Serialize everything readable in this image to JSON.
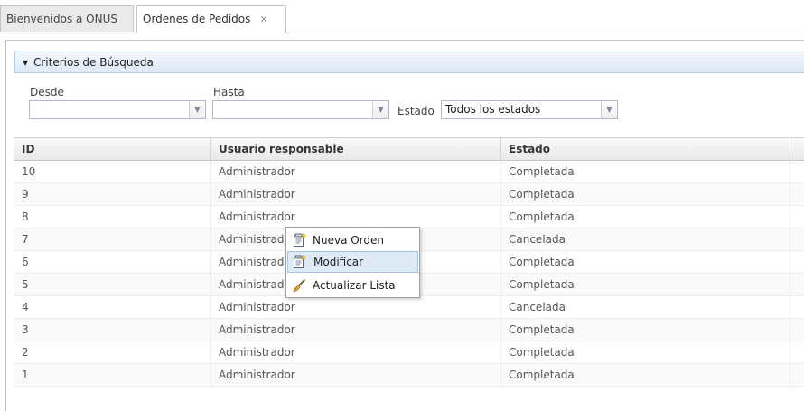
{
  "tabs": [
    {
      "label": "Bienvenidos a ONUS"
    },
    {
      "label": "Ordenes de Pedidos",
      "close": "✕"
    }
  ],
  "criteria": {
    "title": "Criterios de Búsqueda",
    "desde_label": "Desde",
    "desde_value": "",
    "hasta_label": "Hasta",
    "hasta_value": "",
    "estado_label": "Estado",
    "estado_value": "Todos los estados"
  },
  "grid": {
    "columns": [
      "ID",
      "Usuario responsable",
      "Estado"
    ],
    "rows": [
      {
        "id": "10",
        "user": "Administrador",
        "estado": "Completada"
      },
      {
        "id": "9",
        "user": "Administrador",
        "estado": "Completada"
      },
      {
        "id": "8",
        "user": "Administrador",
        "estado": "Completada"
      },
      {
        "id": "7",
        "user": "Administrador",
        "estado": "Cancelada"
      },
      {
        "id": "6",
        "user": "Administrador",
        "estado": "Completada"
      },
      {
        "id": "5",
        "user": "Administrador",
        "estado": "Completada"
      },
      {
        "id": "4",
        "user": "Administrador",
        "estado": "Cancelada"
      },
      {
        "id": "3",
        "user": "Administrador",
        "estado": "Completada"
      },
      {
        "id": "2",
        "user": "Administrador",
        "estado": "Completada"
      },
      {
        "id": "1",
        "user": "Administrador",
        "estado": "Completada"
      }
    ]
  },
  "context_menu": {
    "items": [
      {
        "label": "Nueva Orden",
        "icon": "new-document-icon"
      },
      {
        "label": "Modificar",
        "icon": "edit-document-icon"
      },
      {
        "label": "Actualizar Lista",
        "icon": "refresh-brush-icon"
      }
    ]
  },
  "colors": {
    "header_bg": "#dde9f7",
    "menu_hover": "#dfeaf7",
    "border": "#c5c5c5"
  }
}
